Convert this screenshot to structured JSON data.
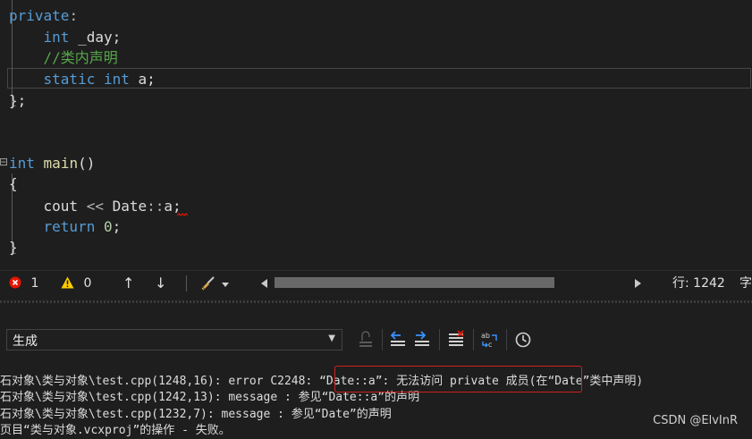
{
  "editor": {
    "lines": [
      {
        "id": "l1",
        "tokens": [
          {
            "t": "private",
            "c": "kw"
          },
          {
            "t": ":",
            "c": "pn"
          }
        ]
      },
      {
        "id": "l2",
        "tokens": [
          {
            "t": "    "
          },
          {
            "t": "int",
            "c": "kw"
          },
          {
            "t": " _day;"
          }
        ]
      },
      {
        "id": "l3",
        "tokens": [
          {
            "t": "    "
          },
          {
            "t": "//类内声明",
            "c": "cm"
          }
        ]
      },
      {
        "id": "l4",
        "tokens": [
          {
            "t": "    "
          },
          {
            "t": "static",
            "c": "kw"
          },
          {
            "t": " "
          },
          {
            "t": "int",
            "c": "kw"
          },
          {
            "t": " a;"
          }
        ]
      },
      {
        "id": "l5",
        "tokens": [
          {
            "t": "};"
          }
        ]
      },
      {
        "id": "l6",
        "tokens": [
          {
            "t": "int",
            "c": "kw"
          },
          {
            "t": " "
          },
          {
            "t": "main",
            "c": "fn"
          },
          {
            "t": "()"
          }
        ]
      },
      {
        "id": "l7",
        "tokens": [
          {
            "t": "{"
          }
        ]
      },
      {
        "id": "l8",
        "tokens": [
          {
            "t": "    cout "
          },
          {
            "t": "<<",
            "c": "pn"
          },
          {
            "t": " Date"
          },
          {
            "t": "::",
            "c": "pn"
          },
          {
            "t": "a;"
          }
        ]
      },
      {
        "id": "l9",
        "tokens": [
          {
            "t": "    "
          },
          {
            "t": "return",
            "c": "kw"
          },
          {
            "t": " "
          },
          {
            "t": "0",
            "c": "nm"
          },
          {
            "t": ";"
          }
        ]
      },
      {
        "id": "l10",
        "tokens": [
          {
            "t": "}"
          }
        ]
      }
    ],
    "collapse_glyph": "⊟"
  },
  "statusbar": {
    "error_count": "1",
    "warning_count": "0",
    "up_arrow": "↑",
    "down_arrow": "↓",
    "line_label": "行: 1242",
    "col_label": "字"
  },
  "output": {
    "source": "生成",
    "lines": [
      "石对象\\类与对象\\test.cpp(1248,16): error C2248: “Date::a”: 无法访问 private 成员(在“Date”类中声明)",
      "石对象\\类与对象\\test.cpp(1242,13): message : 参见“Date::a”的声明",
      "石对象\\类与对象\\test.cpp(1232,7): message : 参见“Date”的声明",
      "页目“类与对象.vcxproj”的操作 - 失败。"
    ]
  },
  "watermark": "CSDN @ElvInR",
  "colors": {
    "background": "#1e1e1e",
    "keyword": "#569cd6",
    "comment": "#57a64a",
    "error": "#e51400",
    "highlight_box": "#d02020"
  }
}
